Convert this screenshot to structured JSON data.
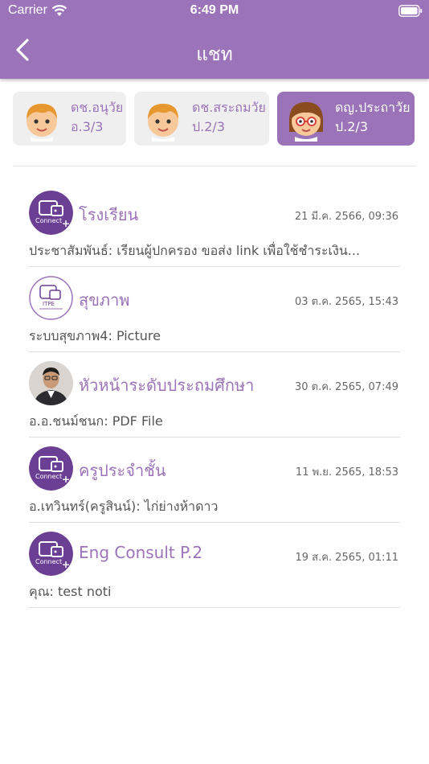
{
  "status_bar": {
    "carrier": "Carrier",
    "time": "6:49 PM"
  },
  "header": {
    "title": "แชท"
  },
  "children": [
    {
      "name": "ดช.อนุวัย",
      "class": "อ.3/3",
      "active": false,
      "avatar": "boy-avatar-icon"
    },
    {
      "name": "ดช.สระถมวัย",
      "class": "ป.2/3",
      "active": false,
      "avatar": "boy-avatar-icon"
    },
    {
      "name": "ดญ.ประถาวัย",
      "class": "ป.2/3",
      "active": true,
      "avatar": "girl-avatar-icon"
    }
  ],
  "chats": [
    {
      "name": "โรงเรียน",
      "time": "21 มี.ค. 2566, 09:36",
      "preview": "ประชาสัมพันธ์: เรียนผู้ปกครอง ขอส่ง link เพื่อใช้ชำระเงิน...",
      "avatar": "connect-logo-icon",
      "logo_text": "Connect"
    },
    {
      "name": "สุขภาพ",
      "time": "03 ต.ค. 2565, 15:43",
      "preview": "ระบบสุขภาพ4: Picture",
      "avatar": "health-logo-icon",
      "logo_text": "ITPE"
    },
    {
      "name": "หัวหน้าระดับประถมศึกษา",
      "time": "30 ต.ค. 2565, 07:49",
      "preview": "อ.อ.ชนม์ชนก: PDF File",
      "avatar": "person-photo-icon"
    },
    {
      "name": "ครูประจำชั้น",
      "time": "11 พ.ย. 2565, 18:53",
      "preview": "อ.เทวินทร์(ครูสินน์): ไก่ย่างห้าดาว",
      "avatar": "connect-logo-icon",
      "logo_text": "Connect"
    },
    {
      "name": "Eng Consult P.2",
      "time": "19 ส.ค. 2565, 01:11",
      "preview": "คุณ: test noti",
      "avatar": "connect-logo-icon",
      "logo_text": "Connect"
    }
  ],
  "colors": {
    "primary": "#9b73b8",
    "tab_inactive": "#efefef"
  }
}
